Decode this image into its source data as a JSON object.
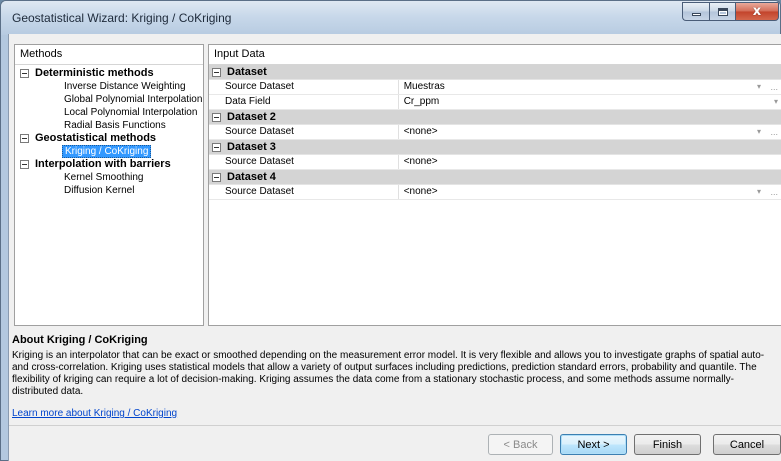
{
  "window": {
    "title": "Geostatistical Wizard: Kriging / CoKriging",
    "minimize_glyph": "",
    "maximize_glyph": "",
    "close_glyph": "x"
  },
  "methods": {
    "header": "Methods",
    "groups": [
      {
        "label": "Deterministic methods",
        "items": [
          "Inverse Distance Weighting",
          "Global Polynomial Interpolation",
          "Local Polynomial Interpolation",
          "Radial Basis Functions"
        ]
      },
      {
        "label": "Geostatistical methods",
        "items": [
          "Kriging / CoKriging"
        ]
      },
      {
        "label": "Interpolation with barriers",
        "items": [
          "Kernel Smoothing",
          "Diffusion Kernel"
        ]
      }
    ],
    "selected": "Kriging / CoKriging"
  },
  "input_data": {
    "header": "Input Data",
    "sections": [
      {
        "label": "Dataset",
        "rows": [
          {
            "name": "Source Dataset",
            "value": "Muestras",
            "dropdown": true,
            "ellipsis": true
          },
          {
            "name": "Data Field",
            "value": "Cr_ppm",
            "dropdown": true,
            "ellipsis": false
          }
        ]
      },
      {
        "label": "Dataset 2",
        "rows": [
          {
            "name": "Source Dataset",
            "value": "<none>",
            "dropdown": true,
            "ellipsis": true
          }
        ]
      },
      {
        "label": "Dataset 3",
        "rows": [
          {
            "name": "Source Dataset",
            "value": "<none>",
            "dropdown": true,
            "ellipsis": false
          }
        ]
      },
      {
        "label": "Dataset 4",
        "rows": [
          {
            "name": "Source Dataset",
            "value": "<none>",
            "dropdown": true,
            "ellipsis": true
          }
        ]
      }
    ],
    "dropdown_glyph": "▾",
    "ellipsis_glyph": "..."
  },
  "about": {
    "title": "About Kriging / CoKriging",
    "text": "Kriging is an interpolator that can be exact or smoothed depending on the measurement error model. It is very flexible and allows you to investigate graphs of spatial auto- and cross-correlation. Kriging uses statistical models that allow a variety of output surfaces including predictions, prediction standard errors, probability and quantile. The flexibility of kriging can require a lot of decision-making. Kriging assumes the data come from a stationary stochastic process, and some methods assume normally-distributed data.",
    "link": "Learn more about Kriging / CoKriging"
  },
  "buttons": {
    "back": "< Back",
    "next": "Next >",
    "finish": "Finish",
    "cancel": "Cancel"
  }
}
